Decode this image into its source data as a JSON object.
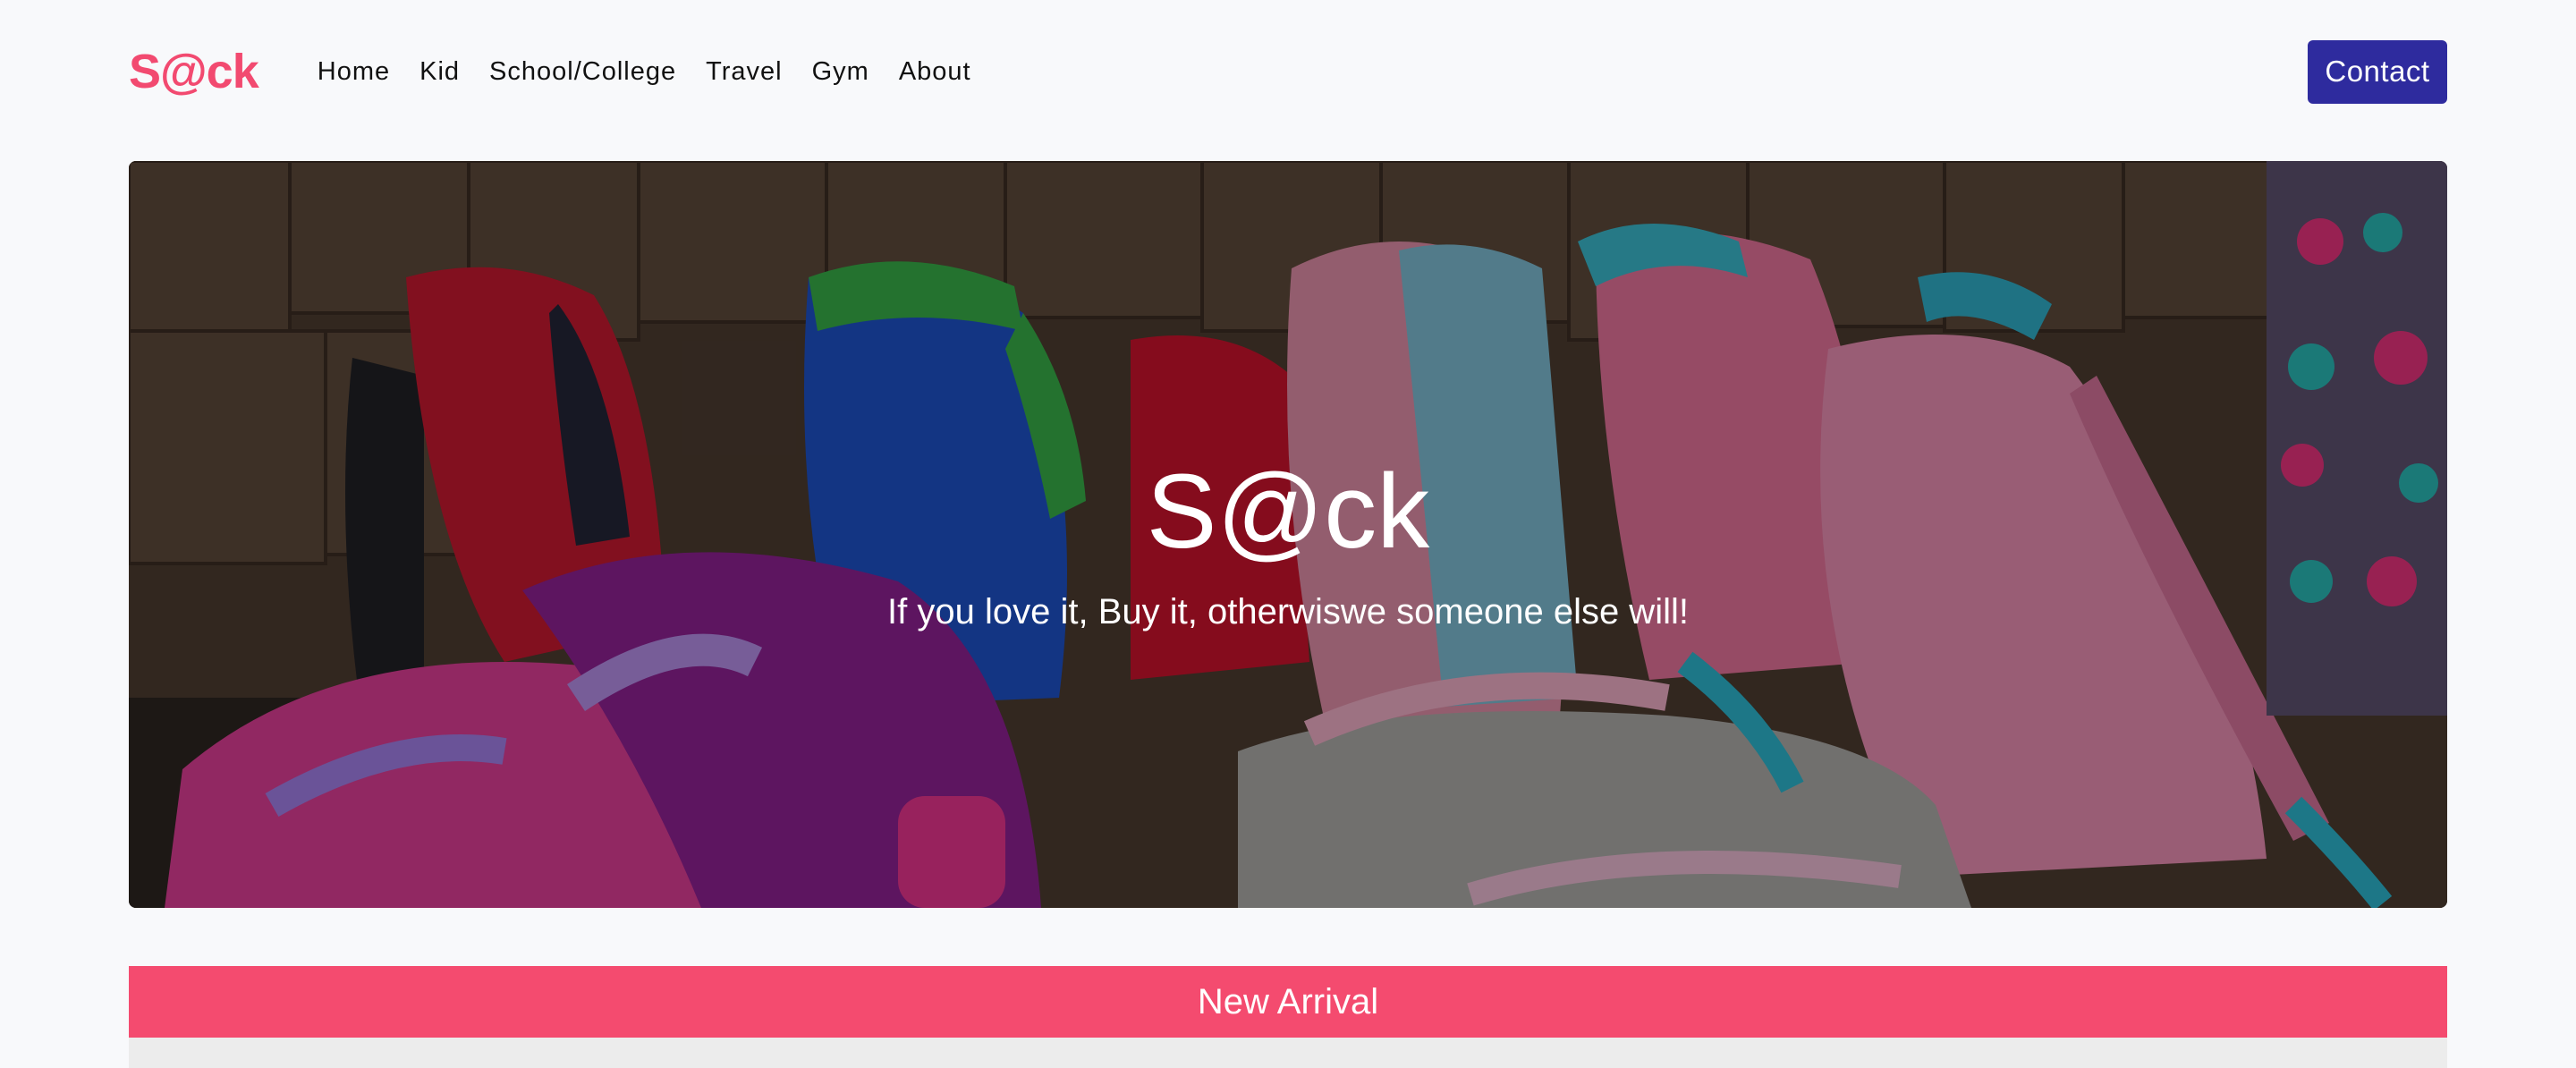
{
  "brand": {
    "logo": "S@ck",
    "accent_color": "#f24a70"
  },
  "nav": {
    "items": [
      {
        "label": "Home"
      },
      {
        "label": "Kid"
      },
      {
        "label": "School/College"
      },
      {
        "label": "Travel"
      },
      {
        "label": "Gym"
      },
      {
        "label": "About"
      }
    ],
    "contact_label": "Contact",
    "contact_color": "#2e2b9e"
  },
  "hero": {
    "title": "S@ck",
    "tagline": "If you love it, Buy it, otherwiswe someone else will!",
    "image_subject": "colorful-backpacks-photo"
  },
  "new_arrival": {
    "heading": "New Arrival",
    "bar_color": "#f44b6f"
  }
}
